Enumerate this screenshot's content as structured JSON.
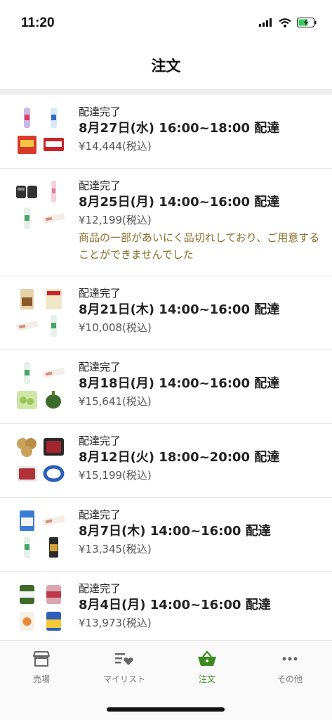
{
  "status_bar": {
    "time": "11:20"
  },
  "header": {
    "title": "注文"
  },
  "orders": [
    {
      "status": "配達完了",
      "delivery": "8月27日(水) 16:00~18:00 配達",
      "price": "¥14,444(税込)",
      "notice": ""
    },
    {
      "status": "配達完了",
      "delivery": "8月25日(月) 14:00~16:00 配達",
      "price": "¥12,199(税込)",
      "notice": "商品の一部があいにく品切れしており、ご用意することができませんでした"
    },
    {
      "status": "配達完了",
      "delivery": "8月21日(木) 14:00~16:00 配達",
      "price": "¥10,008(税込)",
      "notice": ""
    },
    {
      "status": "配達完了",
      "delivery": "8月18日(月) 14:00~16:00 配達",
      "price": "¥15,641(税込)",
      "notice": ""
    },
    {
      "status": "配達完了",
      "delivery": "8月12日(火) 18:00~20:00 配達",
      "price": "¥15,199(税込)",
      "notice": ""
    },
    {
      "status": "配達完了",
      "delivery": "8月7日(木) 14:00~16:00 配達",
      "price": "¥13,345(税込)",
      "notice": ""
    },
    {
      "status": "配達完了",
      "delivery": "8月4日(月) 14:00~16:00 配達",
      "price": "¥13,973(税込)",
      "notice": ""
    }
  ],
  "tabs": [
    {
      "label": "売場",
      "icon": "store-icon"
    },
    {
      "label": "マイリスト",
      "icon": "list-heart-icon"
    },
    {
      "label": "注文",
      "icon": "basket-icon",
      "active": true
    },
    {
      "label": "その他",
      "icon": "more-icon"
    }
  ],
  "colors": {
    "accent": "#3d8b1f",
    "notice": "#8a6d2b"
  }
}
